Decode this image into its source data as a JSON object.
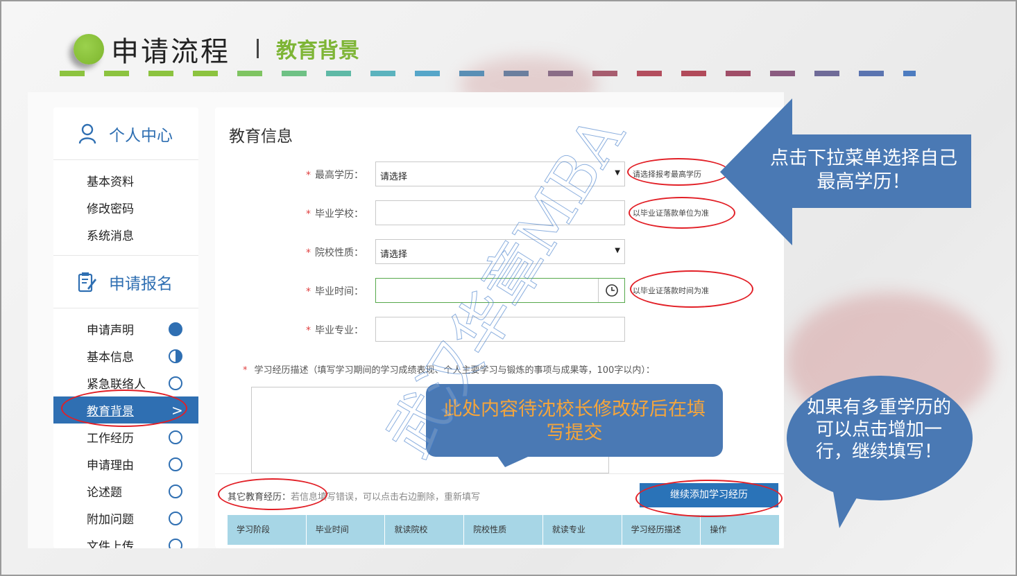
{
  "header": {
    "title": "申请流程",
    "separator": "|",
    "subtitle": "教育背景",
    "dash_colors": [
      "#8cc33f",
      "#8cc33f",
      "#8cc33f",
      "#8cc33f",
      "#7fc462",
      "#6fc185",
      "#5fb9a6",
      "#5cb3be",
      "#56a6c9",
      "#5a8fb5",
      "#6b7f9e",
      "#8a6d87",
      "#a75d6f",
      "#b34e5e",
      "#b14a5a",
      "#a04e68",
      "#8a5b80",
      "#6f6b98",
      "#5b74b0",
      "#4d7cc0"
    ]
  },
  "sidebar": {
    "section1": {
      "title": "个人中心",
      "icon": "user-icon"
    },
    "items1": [
      {
        "label": "基本资料"
      },
      {
        "label": "修改密码"
      },
      {
        "label": "系统消息"
      }
    ],
    "section2": {
      "title": "申请报名",
      "icon": "edit-form-icon"
    },
    "items2": [
      {
        "label": "申请声明",
        "status": "complete"
      },
      {
        "label": "基本信息",
        "status": "partial"
      },
      {
        "label": "紧急联络人",
        "status": "empty"
      },
      {
        "label": "教育背景",
        "status": "active"
      },
      {
        "label": "工作经历",
        "status": "empty"
      },
      {
        "label": "申请理由",
        "status": "empty"
      },
      {
        "label": "论述题",
        "status": "empty"
      },
      {
        "label": "附加问题",
        "status": "empty"
      },
      {
        "label": "文件上传",
        "status": "empty"
      }
    ],
    "active_chevron": ">"
  },
  "main": {
    "title": "教育信息",
    "required_mark": "*",
    "fields": [
      {
        "label": "最高学历：",
        "value": "请选择",
        "hint": "请选择报考最高学历"
      },
      {
        "label": "毕业学校：",
        "value": "",
        "hint": "以毕业证落款单位为准"
      },
      {
        "label": "院校性质：",
        "value": "请选择",
        "hint": ""
      },
      {
        "label": "毕业时间：",
        "value": "",
        "hint": "以毕业证落款时间为准"
      },
      {
        "label": "毕业专业：",
        "value": "",
        "hint": ""
      }
    ],
    "description_label": "学习经历描述（填写学习期间的学习成绩表现、个人主要学习与锻炼的事项与成果等，100字以内）：",
    "other_label": "其它教育经历：",
    "other_hint": "若信息填写错误，可以点击右边删除，重新填写",
    "add_button": "继续添加学习经历",
    "table_headers": [
      "学习阶段",
      "毕业时间",
      "就读院校",
      "院校性质",
      "就读专业",
      "学习经历描述",
      "操作"
    ]
  },
  "callouts": {
    "arrow": "点击下拉菜单选择自己最高学历！",
    "rect": "此处内容待沈校长修改好后在填写提交",
    "bubble": "如果有多重学历的可以点击增加一行，继续填写！"
  },
  "watermark": "武汉华章MBA",
  "colors": {
    "accent_blue": "#2f6fb2",
    "header_green": "#7eb536",
    "callout_blue": "#4a79b4",
    "annotation_red": "#e21f26",
    "table_header": "#a7d6e6"
  }
}
